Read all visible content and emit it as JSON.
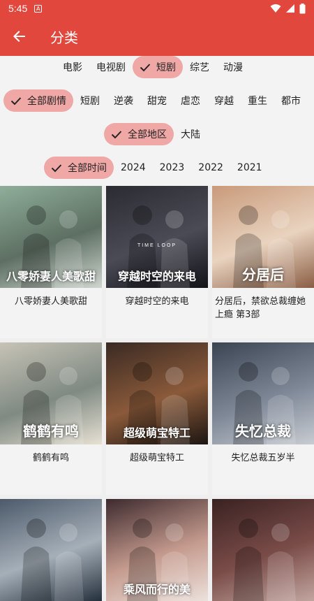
{
  "status": {
    "time": "5:45",
    "sim_label": "A"
  },
  "appbar": {
    "title": "分类"
  },
  "type_row": [
    {
      "label": "电影",
      "selected": false
    },
    {
      "label": "电视剧",
      "selected": false
    },
    {
      "label": "短剧",
      "selected": true
    },
    {
      "label": "综艺",
      "selected": false
    },
    {
      "label": "动漫",
      "selected": false
    }
  ],
  "plot_row": [
    {
      "label": "全部剧情",
      "selected": true
    },
    {
      "label": "短剧",
      "selected": false
    },
    {
      "label": "逆袭",
      "selected": false
    },
    {
      "label": "甜宠",
      "selected": false
    },
    {
      "label": "虐恋",
      "selected": false
    },
    {
      "label": "穿越",
      "selected": false
    },
    {
      "label": "重生",
      "selected": false
    },
    {
      "label": "都市",
      "selected": false
    }
  ],
  "region_row": [
    {
      "label": "全部地区",
      "selected": true
    },
    {
      "label": "大陆",
      "selected": false
    }
  ],
  "year_row": [
    {
      "label": "全部时间",
      "selected": true
    },
    {
      "label": "2024",
      "selected": false
    },
    {
      "label": "2023",
      "selected": false
    },
    {
      "label": "2022",
      "selected": false
    },
    {
      "label": "2021",
      "selected": false
    }
  ],
  "items": [
    {
      "title": "八零娇妻人美歌甜",
      "poster_text": "八零娇妻人美歌甜",
      "colors": [
        "#8fae9a",
        "#5d6f62",
        "#cfd6cf"
      ]
    },
    {
      "title": "穿越时空的来电",
      "poster_text": "穿越时空的来电",
      "poster_sub": "TIME LOOP",
      "colors": [
        "#2b2c32",
        "#4a4b55",
        "#121318"
      ]
    },
    {
      "title": "分居后，禁欲总裁缠她上瘾 第3部",
      "poster_text": "分居后",
      "colors": [
        "#c99a7a",
        "#e9d3bf",
        "#8a5e44"
      ]
    },
    {
      "title": "鹤鹤有鸣",
      "poster_text": "鹤鹤有鸣",
      "colors": [
        "#c7c3b6",
        "#7f8a82",
        "#e7e1d3"
      ]
    },
    {
      "title": "超级萌宝特工",
      "poster_text": "超级萌宝特工",
      "colors": [
        "#3a2a23",
        "#8a5a3a",
        "#1c1512"
      ]
    },
    {
      "title": "失忆总裁五岁半",
      "poster_text": "失忆总裁",
      "colors": [
        "#3b4552",
        "#7d8796",
        "#c8ccd2"
      ]
    },
    {
      "title": "",
      "poster_text": "",
      "colors": [
        "#4c5a6a",
        "#a5afb8",
        "#24303c"
      ]
    },
    {
      "title": "",
      "poster_text": "乘风而行的美",
      "colors": [
        "#3d2a2e",
        "#c59b8e",
        "#ece1dc"
      ]
    },
    {
      "title": "",
      "poster_text": "",
      "colors": [
        "#3a2222",
        "#7a4c48",
        "#c2a59f"
      ]
    }
  ],
  "accent": "#e2473e",
  "chip_selected_bg": "#f0a8a6"
}
